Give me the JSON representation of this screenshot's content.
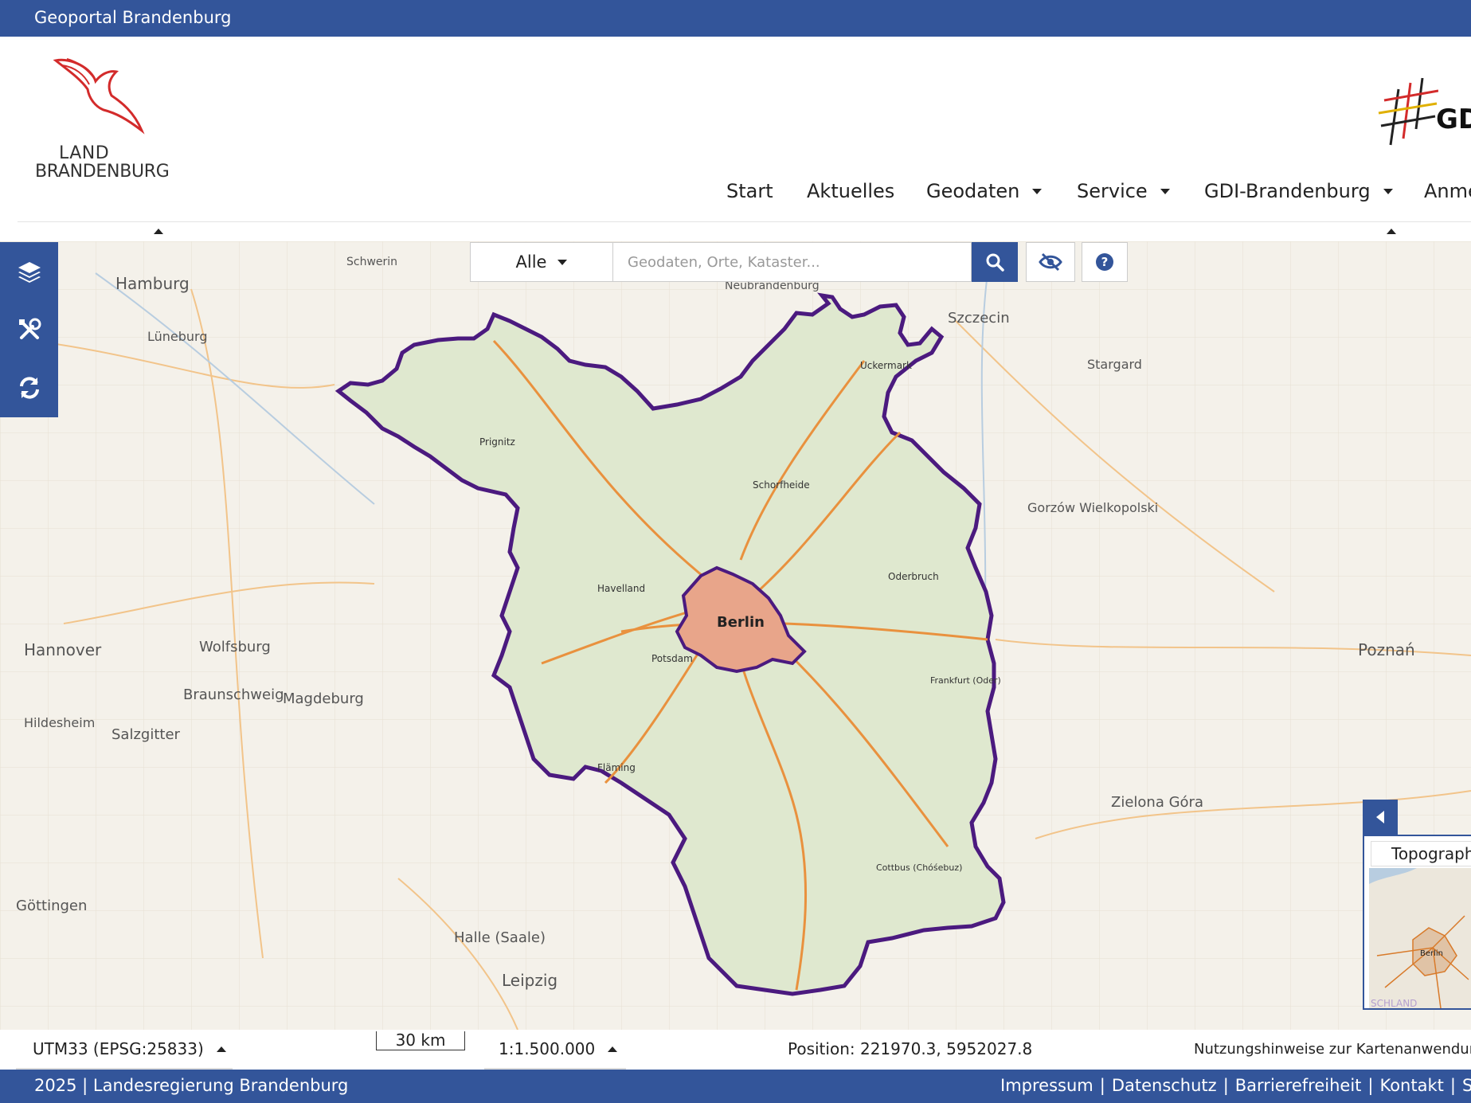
{
  "topbar": {
    "title": "Geoportal Brandenburg"
  },
  "header": {
    "logo_left_line1": "LAND",
    "logo_left_line2": "BRANDENBURG",
    "logo_right_text": "GDI-"
  },
  "nav": {
    "items": [
      {
        "label": "Start",
        "has_dropdown": false
      },
      {
        "label": "Aktuelles",
        "has_dropdown": false
      },
      {
        "label": "Geodaten",
        "has_dropdown": true
      },
      {
        "label": "Service",
        "has_dropdown": true
      },
      {
        "label": "GDI-Brandenburg",
        "has_dropdown": true
      },
      {
        "label": "Anme",
        "has_dropdown": false
      }
    ]
  },
  "left_tools": [
    {
      "icon": "layers-icon"
    },
    {
      "icon": "tools-icon"
    },
    {
      "icon": "refresh-icon"
    }
  ],
  "search": {
    "category": "Alle",
    "placeholder": "Geodaten, Orte, Kataster...",
    "value": ""
  },
  "map": {
    "city_labels": [
      "Berlin",
      "Hamburg",
      "Hannover",
      "Magdeburg",
      "Leipzig",
      "Szczecin",
      "Poznań",
      "Wolfsburg",
      "Braunschweig",
      "Zielona Góra",
      "Gorzów Wielkopolski",
      "Lüneburg",
      "Halle (Saale)",
      "Salzgitter",
      "Hildesheim",
      "Göttingen",
      "Schwerin",
      "Neubrandenburg",
      "Stargard",
      "Cottbus (Chóśebuz)",
      "Frankfurt (Oder)",
      "Potsdam",
      "Prignitz",
      "Fläming",
      "Oderbruch",
      "Havelland",
      "Schorfheide",
      "Uckermark"
    ],
    "boundary_color": "#4b1a7f",
    "berlin_fill": "#e8a58a"
  },
  "overview": {
    "label": "Topograph",
    "city": "Berlin",
    "country_fragment": "SCHLAND"
  },
  "status": {
    "crs": "UTM33 (EPSG:25833)",
    "scale_bar_label": "30 km",
    "scale": "1:1.500.000",
    "position": "Position: 221970.3, 5952027.8",
    "usage_hint": "Nutzungshinweise zur Kartenanwendung"
  },
  "footer": {
    "copyright": "2025 | Landesregierung Brandenburg",
    "links": [
      "Impressum",
      "Datenschutz",
      "Barrierefreiheit",
      "Kontakt",
      "Sit"
    ]
  },
  "colors": {
    "brand_blue": "#33559a"
  }
}
